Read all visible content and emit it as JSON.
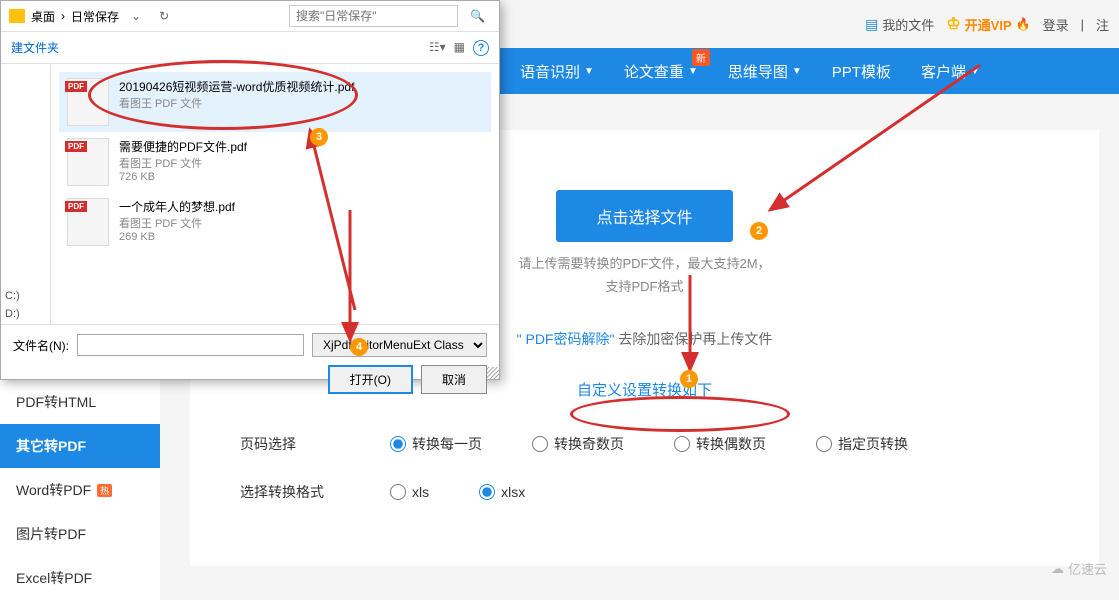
{
  "header": {
    "my_files": "我的文件",
    "vip": "开通VIP",
    "login": "登录",
    "register_sep": "注"
  },
  "nav": {
    "items": [
      {
        "label": "语音识别"
      },
      {
        "label": "论文查重",
        "badge": "新"
      },
      {
        "label": "思维导图"
      },
      {
        "label": "PPT模板"
      },
      {
        "label": "客户端"
      }
    ]
  },
  "sidebar": {
    "pdf2html": "PDF转HTML",
    "other2pdf": "其它转PDF",
    "word2pdf": "Word转PDF",
    "word2pdf_hot": "热",
    "img2pdf": "图片转PDF",
    "excel2pdf": "Excel转PDF"
  },
  "main": {
    "upload_btn": "点击选择文件",
    "hint1": "请上传需要转换的PDF文件，最大支持2M，",
    "hint2": "支持PDF格式",
    "password_link": "\" PDF密码解除\"",
    "password_text": "去除加密保护再上传文件",
    "custom_title": "自定义设置转换如下",
    "page_select_label": "页码选择",
    "page_opts": [
      "转换每一页",
      "转换奇数页",
      "转换偶数页",
      "指定页转换"
    ],
    "format_label": "选择转换格式",
    "format_opts": [
      "xls",
      "xlsx"
    ]
  },
  "dialog": {
    "crumb1": "桌面",
    "crumb2": "日常保存",
    "search_placeholder": "搜索\"日常保存\"",
    "new_folder": "建文件夹",
    "drives": [
      "C:)",
      "D:)"
    ],
    "files": [
      {
        "name": "20190426短视频运营-word优质视频统计.pdf",
        "type": "看图王 PDF 文件",
        "size": ""
      },
      {
        "name": "需要便捷的PDF文件.pdf",
        "type": "看图王 PDF 文件",
        "size": "726 KB"
      },
      {
        "name": "一个成年人的梦想.pdf",
        "type": "看图王 PDF 文件",
        "size": "269 KB"
      }
    ],
    "filename_label": "文件名(N):",
    "filter": "XjPdfEditorMenuExt Class",
    "open_btn": "打开(O)",
    "cancel_btn": "取消"
  },
  "annotations": {
    "n1": "1",
    "n2": "2",
    "n3": "3",
    "n4": "4"
  },
  "watermark": "亿速云"
}
